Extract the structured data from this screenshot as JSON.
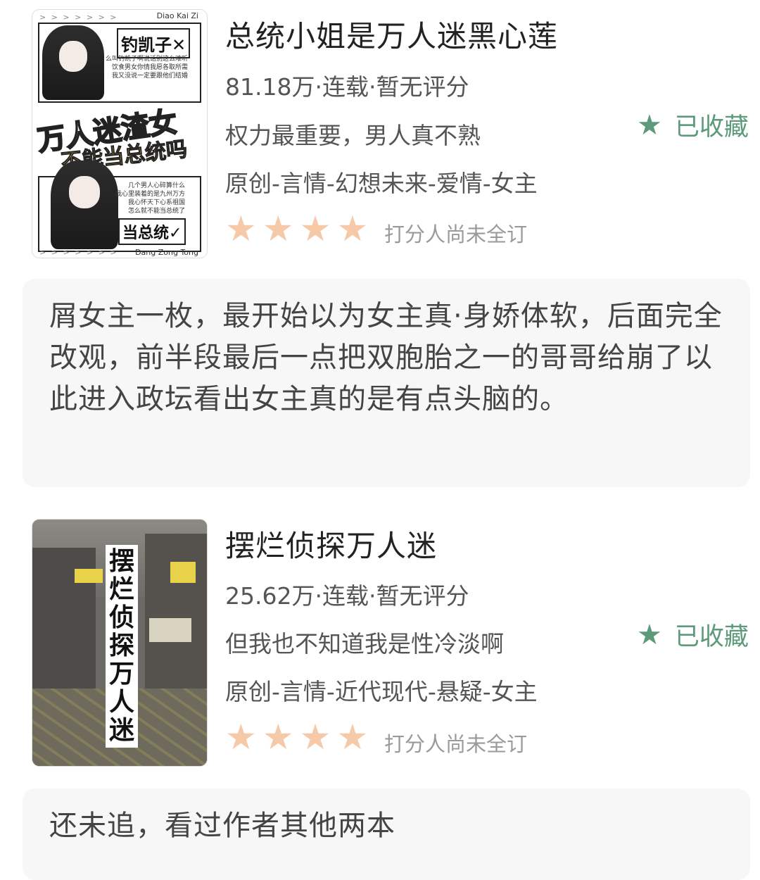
{
  "books": [
    {
      "title": "总统小姐是万人迷黑心莲",
      "meta": "81.18万·连载·暂无评分",
      "tagline": "权力最重要，男人真不熟",
      "tags": "原创-言情-幻想未来-爱情-女主",
      "stars": 4,
      "rating_note": "打分人尚未全订",
      "favorite_label": "已收藏",
      "cover": {
        "top_right": "Diao   Kai   Zi",
        "bottom_right": "Dang  Zong  Tong",
        "label1": "钓凯子✕",
        "big_text": "万人迷渣女",
        "yellow_text": "不能当总统吗",
        "label2": "当总统✓",
        "small_lines_1": [
          "么叫钓凯子啊说话别这么难听",
          "饮食男女你情我愿各取所需",
          "我又没说一定要跟他们结婚"
        ],
        "small_lines_2": [
          "几个男人心碎算什么",
          "我心里装着的是九州万方",
          "我心怀天下心系祖国",
          "怎么就不能当总统了"
        ]
      },
      "review": "屑女主一枚，最开始以为女主真·身娇体软，后面完全改观，前半段最后一点把双胞胎之一的哥哥给崩了以此进入政坛看出女主真的是有点头脑的。"
    },
    {
      "title": "摆烂侦探万人迷",
      "meta": "25.62万·连载·暂无评分",
      "tagline": "但我也不知道我是性冷淡啊",
      "tags": "原创-言情-近代现代-悬疑-女主",
      "stars": 4,
      "rating_note": "打分人尚未全订",
      "favorite_label": "已收藏",
      "cover": {
        "vertical_title": "摆烂侦探万人迷"
      },
      "review": "还未追，看过作者其他两本"
    }
  ],
  "colors": {
    "accent_green": "#5c9a7a",
    "star_peach": "#f6c9a8",
    "review_bg": "#f6f7f6"
  },
  "icons": {
    "favorite": "star-icon",
    "rating": "star-icon"
  }
}
